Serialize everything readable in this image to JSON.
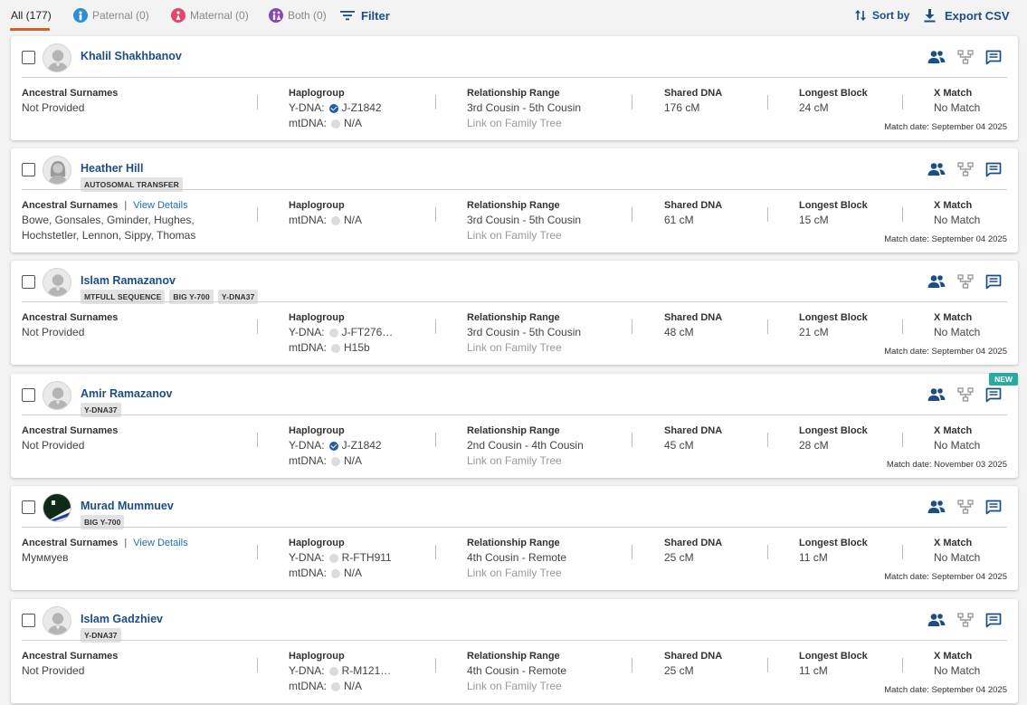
{
  "toolbar": {
    "tabs": [
      {
        "label": "All (177)"
      },
      {
        "label": "Paternal (0)"
      },
      {
        "label": "Maternal (0)"
      },
      {
        "label": "Both (0)"
      }
    ],
    "filter_label": "Filter",
    "sort_label": "Sort by",
    "export_label": "Export CSV"
  },
  "labels": {
    "ancestral_surnames": "Ancestral Surnames",
    "view_details": "View Details",
    "haplogroup": "Haplogroup",
    "relationship_range": "Relationship Range",
    "shared_dna": "Shared DNA",
    "longest_block": "Longest Block",
    "x_match": "X Match",
    "link_family_tree": "Link on Family Tree",
    "ydna_key": "Y-DNA:",
    "mtdna_key": "mtDNA:",
    "new_tag": "NEW"
  },
  "colors": {
    "brand_blue": "#1c4e86",
    "accent_orange": "#e0592a",
    "new_teal": "#29a9a0"
  },
  "matches": [
    {
      "name": "Khalil Shakhbanov",
      "avatar": "male-silhouette-icon",
      "badges": [],
      "surnames": [
        "Not Provided"
      ],
      "view_details": false,
      "ydna": "J-Z1842",
      "ydna_confirmed": true,
      "mtdna": "N/A",
      "relationship": "3rd Cousin - 5th Cousin",
      "shared_dna": "176 cM",
      "longest_block": "24 cM",
      "x_match": "No Match",
      "match_date": "Match date: September 04 2025",
      "is_new": false
    },
    {
      "name": "Heather Hill",
      "avatar": "female-silhouette-icon",
      "badges": [
        "AUTOSOMAL TRANSFER"
      ],
      "surnames": [
        "Bowe, Gonsales, Gminder, Hughes,",
        "Hochstetler, Lennon, Sippy, Thomas"
      ],
      "view_details": true,
      "ydna": null,
      "ydna_confirmed": false,
      "mtdna": "N/A",
      "relationship": "3rd Cousin - 5th Cousin",
      "shared_dna": "61 cM",
      "longest_block": "15 cM",
      "x_match": "No Match",
      "match_date": "Match date: September 04 2025",
      "is_new": false
    },
    {
      "name": "Islam Ramazanov",
      "avatar": "male-silhouette-icon",
      "badges": [
        "MTFULL SEQUENCE",
        "BIG Y-700",
        "Y-DNA37"
      ],
      "surnames": [
        "Not Provided"
      ],
      "view_details": false,
      "ydna": "J-FT276…",
      "ydna_confirmed": false,
      "mtdna": "H15b",
      "relationship": "3rd Cousin - 5th Cousin",
      "shared_dna": "48 cM",
      "longest_block": "21 cM",
      "x_match": "No Match",
      "match_date": "Match date: September 04 2025",
      "is_new": false
    },
    {
      "name": "Amir Ramazanov",
      "avatar": "male-silhouette-icon",
      "badges": [
        "Y-DNA37"
      ],
      "surnames": [
        "Not Provided"
      ],
      "view_details": false,
      "ydna": "J-Z1842",
      "ydna_confirmed": true,
      "mtdna": "N/A",
      "relationship": "2nd Cousin - 4th Cousin",
      "shared_dna": "45 cM",
      "longest_block": "28 cM",
      "x_match": "No Match",
      "match_date": "Match date: November 03 2025",
      "is_new": true
    },
    {
      "name": "Murad Mummuev",
      "avatar": "custom-photo-avatar",
      "badges": [
        "BIG Y-700"
      ],
      "surnames": [
        "Муммуев"
      ],
      "view_details": true,
      "ydna": "R-FTH911",
      "ydna_confirmed": false,
      "mtdna": "N/A",
      "relationship": "4th Cousin - Remote",
      "shared_dna": "25 cM",
      "longest_block": "11 cM",
      "x_match": "No Match",
      "match_date": "Match date: September 04 2025",
      "is_new": false
    },
    {
      "name": "Islam Gadzhiev",
      "avatar": "male-silhouette-icon",
      "badges": [
        "Y-DNA37"
      ],
      "surnames": [
        "Not Provided"
      ],
      "view_details": false,
      "ydna": "R-M121…",
      "ydna_confirmed": false,
      "mtdna": "N/A",
      "relationship": "4th Cousin - Remote",
      "shared_dna": "25 cM",
      "longest_block": "11 cM",
      "x_match": "No Match",
      "match_date": "Match date: September 04 2025",
      "is_new": false
    }
  ]
}
